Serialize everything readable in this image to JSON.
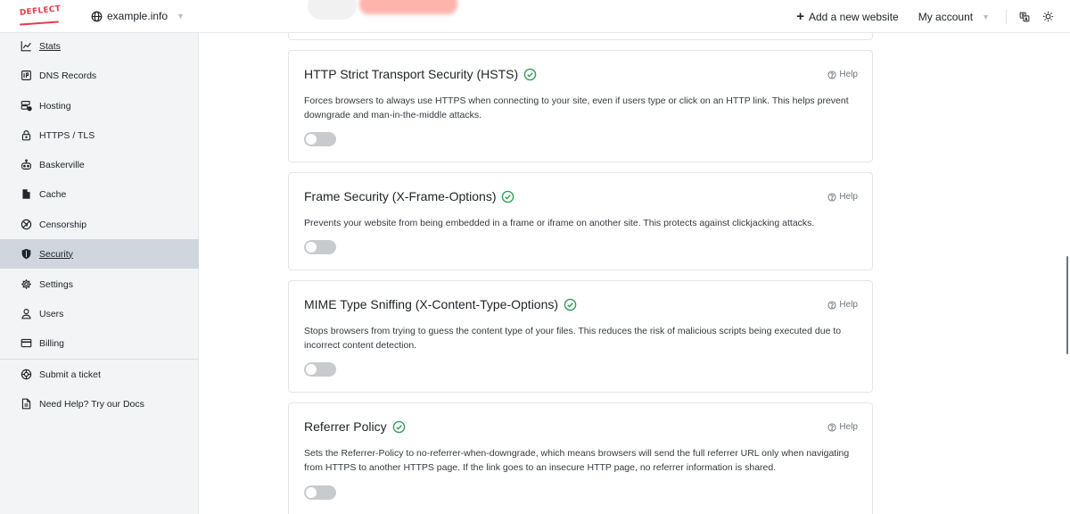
{
  "header": {
    "logo_text": "DEFLECT",
    "site": "example.info",
    "add_site_label": "Add a new website",
    "account_label": "My account"
  },
  "sidebar": {
    "items": [
      {
        "label": "Stats",
        "icon": "chart-line-icon"
      },
      {
        "label": "DNS Records",
        "icon": "dns-icon"
      },
      {
        "label": "Hosting",
        "icon": "server-icon"
      },
      {
        "label": "HTTPS / TLS",
        "icon": "lock-icon"
      },
      {
        "label": "Baskerville",
        "icon": "robot-icon"
      },
      {
        "label": "Cache",
        "icon": "file-icon"
      },
      {
        "label": "Censorship",
        "icon": "globe-slash-icon"
      },
      {
        "label": "Security",
        "icon": "shield-icon",
        "active": true
      },
      {
        "label": "Settings",
        "icon": "gear-icon"
      },
      {
        "label": "Users",
        "icon": "user-icon"
      },
      {
        "label": "Billing",
        "icon": "credit-card-icon"
      }
    ],
    "footer_items": [
      {
        "label": "Submit a ticket",
        "icon": "lifebuoy-icon"
      },
      {
        "label": "Need Help? Try our Docs",
        "icon": "document-icon"
      }
    ]
  },
  "cards": [
    {
      "title": "HTTP Strict Transport Security (HSTS)",
      "help_label": "Help",
      "description": "Forces browsers to always use HTTPS when connecting to your site, even if users type or click on an HTTP link. This helps prevent downgrade and man-in-the-middle attacks.",
      "enabled": false
    },
    {
      "title": "Frame Security (X-Frame-Options)",
      "help_label": "Help",
      "description": "Prevents your website from being embedded in a frame or iframe on another site. This protects against clickjacking attacks.",
      "enabled": false
    },
    {
      "title": "MIME Type Sniffing (X-Content-Type-Options)",
      "help_label": "Help",
      "description": "Stops browsers from trying to guess the content type of your files. This reduces the risk of malicious scripts being executed due to incorrect content detection.",
      "enabled": false
    },
    {
      "title": "Referrer Policy",
      "help_label": "Help",
      "description": "Sets the Referrer-Policy to no-referrer-when-downgrade, which means browsers will send the full referrer URL only when navigating from HTTPS to another HTTPS page. If the link goes to an insecure HTTP page, no referrer information is shared.",
      "enabled": false
    }
  ],
  "colors": {
    "brand": "#e43d4b",
    "check": "#2f9e5b",
    "active_nav": "#cfd6de",
    "toggle_off": "#c8cbce"
  }
}
